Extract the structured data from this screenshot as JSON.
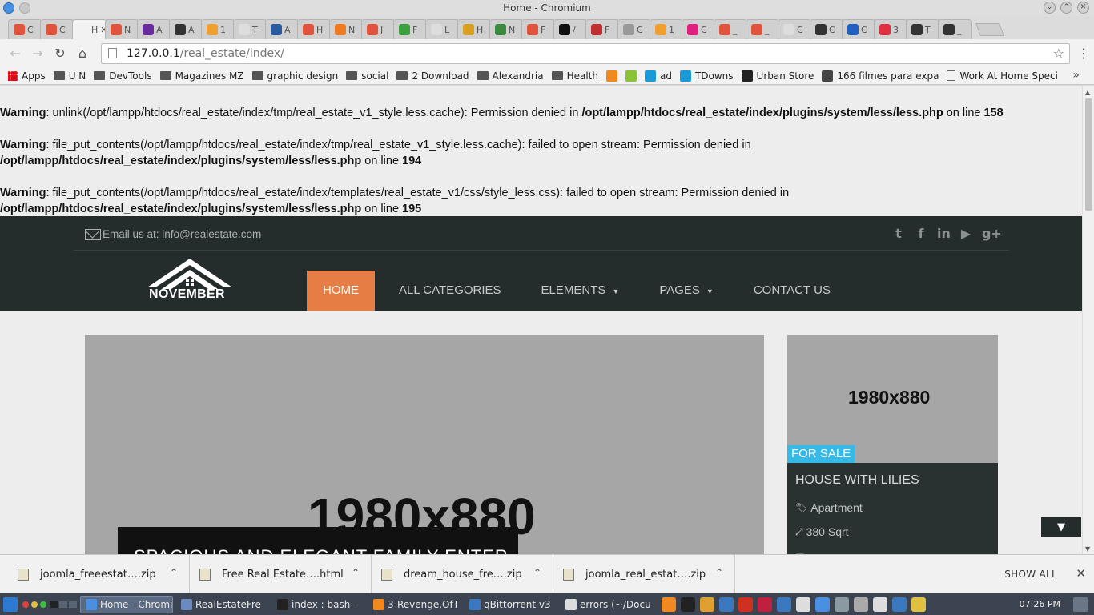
{
  "window": {
    "title": "Home - Chromium"
  },
  "tabs": [
    {
      "label": "C",
      "color": "#e0533c"
    },
    {
      "label": "C",
      "color": "#e0533c"
    },
    {
      "label": "H",
      "color": "#f2f2f2",
      "active": true
    },
    {
      "label": "N",
      "color": "#e0533c"
    },
    {
      "label": "A",
      "color": "#6a2aa0"
    },
    {
      "label": "A",
      "color": "#333333"
    },
    {
      "label": "1",
      "color": "#f0a030"
    },
    {
      "label": "T",
      "color": "#dddddd"
    },
    {
      "label": "A",
      "color": "#2a5aa0"
    },
    {
      "label": "H",
      "color": "#e0533c"
    },
    {
      "label": "N",
      "color": "#f07a20"
    },
    {
      "label": "J",
      "color": "#e0533c"
    },
    {
      "label": "F",
      "color": "#3aa040"
    },
    {
      "label": "L",
      "color": "#dddddd"
    },
    {
      "label": "H",
      "color": "#d8a020"
    },
    {
      "label": "N",
      "color": "#3a8a40"
    },
    {
      "label": "F",
      "color": "#e0533c"
    },
    {
      "label": "/",
      "color": "#111111"
    },
    {
      "label": "F",
      "color": "#c03030"
    },
    {
      "label": "C",
      "color": "#999999"
    },
    {
      "label": "1",
      "color": "#f0a030"
    },
    {
      "label": "C",
      "color": "#e02080"
    },
    {
      "label": "_",
      "color": "#e0533c"
    },
    {
      "label": "_",
      "color": "#e0533c"
    },
    {
      "label": "C",
      "color": "#dddddd"
    },
    {
      "label": "C",
      "color": "#333333"
    },
    {
      "label": "C",
      "color": "#2060c0"
    },
    {
      "label": "3",
      "color": "#e03040"
    },
    {
      "label": "T",
      "color": "#333333"
    },
    {
      "label": "_",
      "color": "#333333"
    }
  ],
  "toolbar": {
    "url_host": "127.0.0.1",
    "url_path": "/real_estate/index/",
    "back_icon": "←",
    "forward_icon": "→",
    "reload_icon": "↻",
    "home_icon": "⌂",
    "star_icon": "☆",
    "menu_icon": "⋮"
  },
  "bookmarks": [
    {
      "label": "Apps",
      "type": "grid"
    },
    {
      "label": "U N",
      "type": "folder"
    },
    {
      "label": "DevTools",
      "type": "folder"
    },
    {
      "label": "Magazines MZ",
      "type": "folder"
    },
    {
      "label": "graphic design",
      "type": "folder"
    },
    {
      "label": "social",
      "type": "folder"
    },
    {
      "label": "2 Download",
      "type": "folder"
    },
    {
      "label": "Alexandria",
      "type": "folder"
    },
    {
      "label": "Health",
      "type": "folder"
    },
    {
      "label": "",
      "type": "icon",
      "color": "#f08a20"
    },
    {
      "label": "",
      "type": "icon",
      "color": "#8ac23a"
    },
    {
      "label": "ad",
      "type": "icon",
      "color": "#1a9ad6"
    },
    {
      "label": "TDowns",
      "type": "icon",
      "color": "#1a9ad6"
    },
    {
      "label": "Urban Store",
      "type": "icon",
      "color": "#222222"
    },
    {
      "label": "166 filmes para expa",
      "type": "icon",
      "color": "#444444"
    },
    {
      "label": "Work At Home Speci",
      "type": "doc"
    }
  ],
  "bookmarks_more": "»",
  "warnings": [
    {
      "label": "Warning",
      "text": ": unlink(/opt/lampp/htdocs/real_estate/index/tmp/real_estate_v1_style.less.cache): Permission denied in ",
      "path": "/opt/lampp/htdocs/real_estate/index/plugins/system/less/less.php",
      "on_line": " on line ",
      "line": "158"
    },
    {
      "label": "Warning",
      "text": ": file_put_contents(/opt/lampp/htdocs/real_estate/index/tmp/real_estate_v1_style.less.cache): failed to open stream: Permission denied in ",
      "path": "/opt/lampp/htdocs/real_estate/index/plugins/system/less/less.php",
      "on_line": " on line ",
      "line": "194"
    },
    {
      "label": "Warning",
      "text": ": file_put_contents(/opt/lampp/htdocs/real_estate/index/templates/real_estate_v1/css/style_less.css): failed to open stream: Permission denied in ",
      "path": "/opt/lampp/htdocs/real_estate/index/plugins/system/less/less.php",
      "on_line": " on line ",
      "line": "195"
    }
  ],
  "site": {
    "email_text": "Email us at: info@realestate.com",
    "socials": [
      {
        "name": "twitter-icon",
        "glyph": "t"
      },
      {
        "name": "facebook-icon",
        "glyph": "f"
      },
      {
        "name": "linkedin-icon",
        "glyph": "in"
      },
      {
        "name": "youtube-icon",
        "glyph": "▶"
      },
      {
        "name": "google-plus-icon",
        "glyph": "g+"
      }
    ],
    "logo_text": "NOVEMBER",
    "nav": [
      {
        "label": "HOME",
        "active": true,
        "dropdown": false
      },
      {
        "label": "ALL CATEGORIES",
        "active": false,
        "dropdown": false
      },
      {
        "label": "ELEMENTS",
        "active": false,
        "dropdown": true
      },
      {
        "label": "PAGES",
        "active": false,
        "dropdown": true
      },
      {
        "label": "CONTACT US",
        "active": false,
        "dropdown": false
      }
    ],
    "hero": {
      "placeholder": "1980x880",
      "caption": "SPACIOUS AND ELEGANT FAMILY ENTER"
    },
    "card": {
      "placeholder": "1980x880",
      "badge": "FOR SALE",
      "title": "HOUSE WITH LILIES",
      "type": "Apartment",
      "area": "380 Sqrt"
    },
    "scroll_top_icon": "▼",
    "colors": {
      "accent": "#e67d44",
      "header_bg": "#252c2c",
      "badge": "#36b9e6"
    }
  },
  "downloads": [
    {
      "name": "joomla_freeestat….zip"
    },
    {
      "name": "Free Real Estate….html"
    },
    {
      "name": "dream_house_fre….zip"
    },
    {
      "name": "joomla_real_estat….zip"
    }
  ],
  "downloads_show_all": "SHOW ALL",
  "downloads_close": "✕",
  "taskbar": {
    "tasks": [
      {
        "label": "Home - Chromi",
        "active": true,
        "color": "#4a90e2"
      },
      {
        "label": "RealEstateFre",
        "active": false,
        "color": "#6a8ac0"
      },
      {
        "label": "index : bash –",
        "active": false,
        "color": "#222222"
      },
      {
        "label": "3-Revenge.OfT",
        "active": false,
        "color": "#f08a20"
      },
      {
        "label": "qBittorrent v3",
        "active": false,
        "color": "#3a78c0"
      },
      {
        "label": "errors (~/Docu",
        "active": false,
        "color": "#dddddd"
      }
    ],
    "tray_colors": [
      "#f08a20",
      "#222222",
      "#e0a030",
      "#3a78c0",
      "#d03020",
      "#c02040",
      "#3a78c0",
      "#dddddd",
      "#4a90e2",
      "#8a9aa0",
      "#aaaaaa",
      "#dddddd",
      "#3a78c0",
      "#e0c040"
    ],
    "clock": "07:26 PM"
  }
}
